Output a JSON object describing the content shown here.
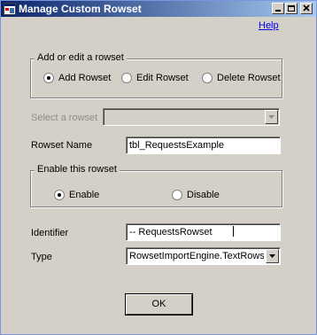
{
  "window": {
    "title": "Manage Custom Rowset",
    "icon": "app-icon",
    "controls": [
      "minimize-icon",
      "maximize-icon",
      "close-icon"
    ]
  },
  "help_link": "Help",
  "add_edit_group": {
    "legend": "Add or edit a rowset",
    "options": [
      {
        "label": "Add Rowset",
        "checked": true
      },
      {
        "label": "Edit Rowset",
        "checked": false
      },
      {
        "label": "Delete Rowset",
        "checked": false
      }
    ]
  },
  "select_rowset": {
    "label": "Select a rowset",
    "value": "",
    "enabled": false
  },
  "rowset_name": {
    "label": "Rowset Name",
    "value": "tbl_RequestsExample"
  },
  "enable_group": {
    "legend": "Enable this rowset",
    "options": [
      {
        "label": "Enable",
        "checked": true
      },
      {
        "label": "Disable",
        "checked": false
      }
    ]
  },
  "identifier": {
    "label": "Identifier",
    "value": "-- RequestsRowset"
  },
  "type": {
    "label": "Type",
    "value": "RowsetImportEngine.TextRowset"
  },
  "ok_button": "OK"
}
